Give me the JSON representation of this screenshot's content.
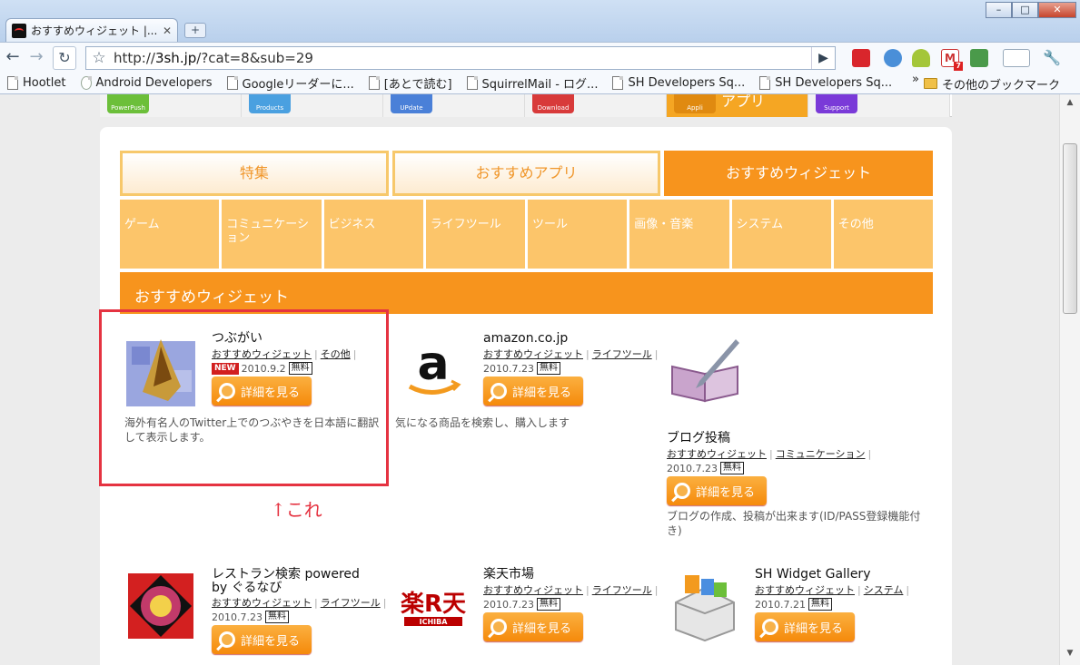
{
  "browser": {
    "tab_title": "おすすめウィジェット |...",
    "url_prefix": "http://",
    "url_host": "3sh.jp",
    "url_path": "/?cat=8&sub=29",
    "window_controls": [
      "–",
      "□",
      "✕"
    ],
    "bookmarks": [
      {
        "label": "Hootlet",
        "icon": "page"
      },
      {
        "label": "Android Developers",
        "icon": "android"
      },
      {
        "label": "Googleリーダーに...",
        "icon": "page"
      },
      {
        "label": "[あとで読む]",
        "icon": "page"
      },
      {
        "label": "SquirrelMail - ログ...",
        "icon": "page"
      },
      {
        "label": "SH Developers Sq...",
        "icon": "page"
      },
      {
        "label": "SH Developers Sq...",
        "icon": "page"
      }
    ],
    "bookmarks_more": "»",
    "other_bookmarks": "その他のブックマーク",
    "gmail_count": "7"
  },
  "site_nav": [
    {
      "icon_label": "PowerPush",
      "color": "#6cbf3a"
    },
    {
      "icon_label": "Products",
      "color": "#4aa0e0"
    },
    {
      "icon_label": "UPdate",
      "color": "#4a80d8"
    },
    {
      "icon_label": "Download",
      "color": "#d83a3a"
    },
    {
      "icon_label": "Appli",
      "color": "#e08a10",
      "label": "アプリ",
      "active": true
    },
    {
      "icon_label": "Support",
      "color": "#7a3ad8"
    }
  ],
  "tabs": [
    {
      "label": "特集"
    },
    {
      "label": "おすすめアプリ"
    },
    {
      "label": "おすすめウィジェット",
      "active": true
    }
  ],
  "categories": [
    "ゲーム",
    "コミュニケーション",
    "ビジネス",
    "ライフツール",
    "ツール",
    "画像・音楽",
    "システム",
    "その他"
  ],
  "section_title": "おすすめウィジェット",
  "detail_button_label": "詳細を見る",
  "free_label": "無料",
  "new_label": "NEW",
  "items": [
    {
      "name": "つぶがい",
      "tags": [
        "おすすめウィジェット",
        "その他"
      ],
      "date": "2010.9.2",
      "is_new": true,
      "description": "海外有名人のTwitter上でのつぶやきを日本語に翻訳して表示します。"
    },
    {
      "name": "amazon.co.jp",
      "tags": [
        "おすすめウィジェット",
        "ライフツール"
      ],
      "date": "2010.7.23",
      "description": "気になる商品を検索し、購入します"
    },
    {
      "name": "ブログ投稿",
      "tags": [
        "おすすめウィジェット",
        "コミュニケーション"
      ],
      "date": "2010.7.23",
      "description": "ブログの作成、投稿が出来ます(ID/PASS登録機能付き)"
    },
    {
      "name": "レストラン検索 powered by ぐるなび",
      "tags": [
        "おすすめウィジェット",
        "ライフツール"
      ],
      "date": "2010.7.23"
    },
    {
      "name": "楽天市場",
      "tags": [
        "おすすめウィジェット",
        "ライフツール"
      ],
      "date": "2010.7.23"
    },
    {
      "name": "SH Widget Gallery",
      "tags": [
        "おすすめウィジェット",
        "システム"
      ],
      "date": "2010.7.21"
    }
  ],
  "annotation": "↑これ",
  "colors": {
    "accent": "#f7941d",
    "highlight": "#e53341"
  }
}
